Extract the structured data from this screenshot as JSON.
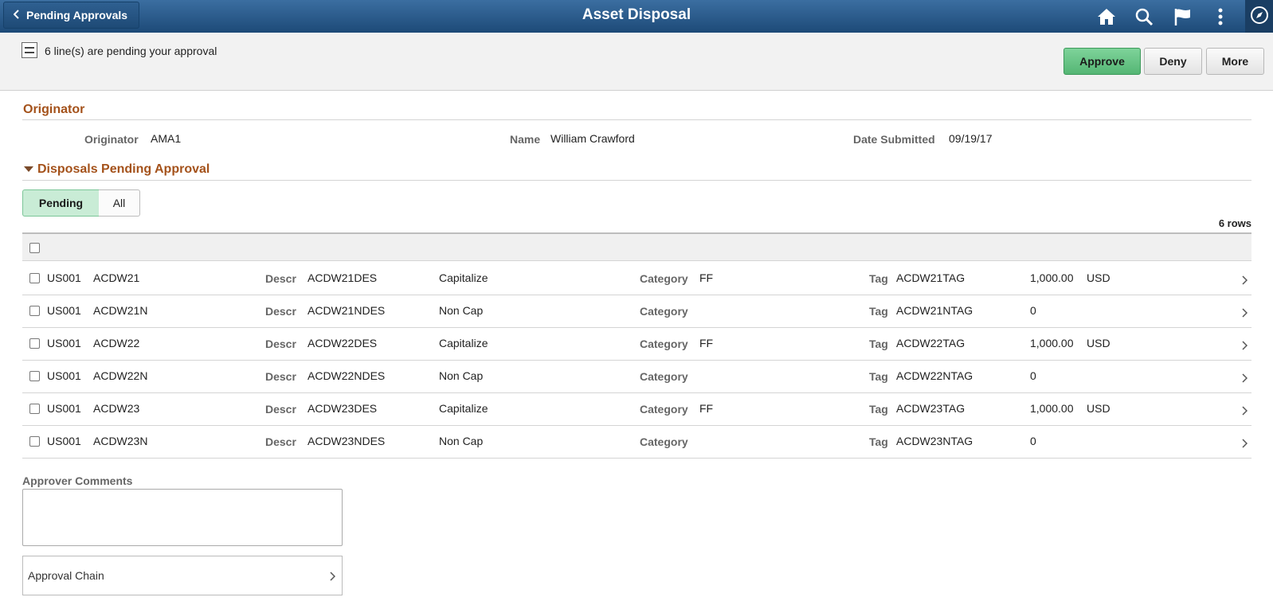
{
  "header": {
    "back_label": "Pending Approvals",
    "title": "Asset Disposal",
    "icons": [
      "home-icon",
      "search-icon",
      "flag-icon",
      "more-vertical-icon",
      "compass-icon"
    ]
  },
  "actionbar": {
    "pending_text": "6 line(s) are pending your approval",
    "approve_label": "Approve",
    "deny_label": "Deny",
    "more_label": "More"
  },
  "originator": {
    "section_title": "Originator",
    "originator_label": "Originator",
    "originator_value": "AMA1",
    "name_label": "Name",
    "name_value": "William Crawford",
    "date_label": "Date Submitted",
    "date_value": "09/19/17"
  },
  "disposals": {
    "section_title": "Disposals Pending Approval",
    "tabs": {
      "pending": "Pending",
      "all": "All",
      "selected": "Pending"
    },
    "row_count": "6 rows",
    "labels": {
      "descr": "Descr",
      "category": "Category",
      "tag": "Tag"
    },
    "rows": [
      {
        "unit": "US001",
        "asset": "ACDW21",
        "descr": "ACDW21DES",
        "cap": "Capitalize",
        "category": "FF",
        "tag": "ACDW21TAG",
        "amount": "1,000.00",
        "currency": "USD"
      },
      {
        "unit": "US001",
        "asset": "ACDW21N",
        "descr": "ACDW21NDES",
        "cap": "Non Cap",
        "category": "",
        "tag": "ACDW21NTAG",
        "amount": "0",
        "currency": ""
      },
      {
        "unit": "US001",
        "asset": "ACDW22",
        "descr": "ACDW22DES",
        "cap": "Capitalize",
        "category": "FF",
        "tag": "ACDW22TAG",
        "amount": "1,000.00",
        "currency": "USD"
      },
      {
        "unit": "US001",
        "asset": "ACDW22N",
        "descr": "ACDW22NDES",
        "cap": "Non Cap",
        "category": "",
        "tag": "ACDW22NTAG",
        "amount": "0",
        "currency": ""
      },
      {
        "unit": "US001",
        "asset": "ACDW23",
        "descr": "ACDW23DES",
        "cap": "Capitalize",
        "category": "FF",
        "tag": "ACDW23TAG",
        "amount": "1,000.00",
        "currency": "USD"
      },
      {
        "unit": "US001",
        "asset": "ACDW23N",
        "descr": "ACDW23NDES",
        "cap": "Non Cap",
        "category": "",
        "tag": "ACDW23NTAG",
        "amount": "0",
        "currency": ""
      }
    ]
  },
  "comments": {
    "label": "Approver Comments",
    "value": ""
  },
  "approval_chain": {
    "label": "Approval Chain"
  },
  "colors": {
    "header_bg": "#2a5a8a",
    "section_title": "#a4521b",
    "approve_bg": "#6cc489",
    "pending_tab_bg": "#c9ecd6"
  }
}
